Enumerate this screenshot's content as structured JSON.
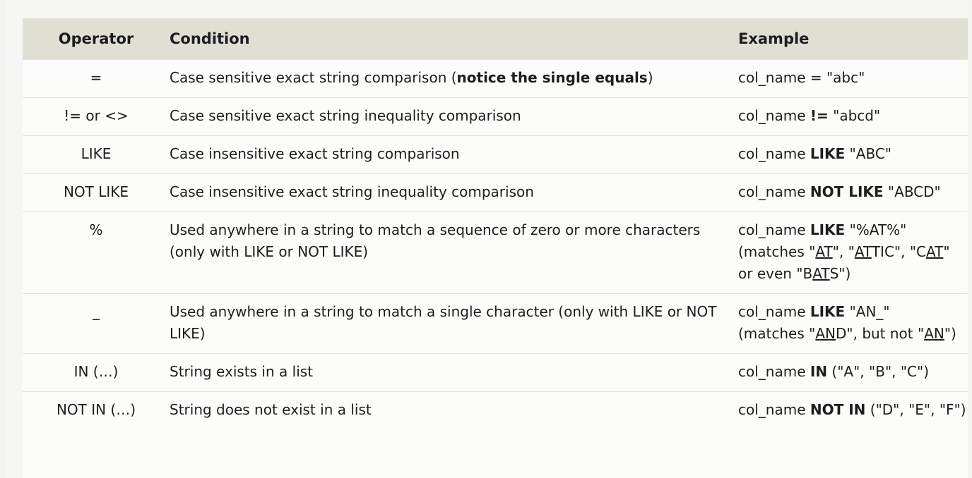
{
  "header": {
    "operator": "Operator",
    "condition": "Condition",
    "example": "Example"
  },
  "rows": [
    {
      "operator": "=",
      "condition_pre": "Case sensitive exact string comparison (",
      "condition_bold": "notice the single equals",
      "condition_post": ")",
      "ex_1": "col_name = \"abc\""
    },
    {
      "operator": "!= or <>",
      "condition": "Case sensitive exact string inequality comparison",
      "ex_1": "col_name ",
      "ex_bold": "!=",
      "ex_2": " \"abcd\""
    },
    {
      "operator": "LIKE",
      "condition": "Case insensitive exact string comparison",
      "ex_1": "col_name ",
      "ex_bold": "LIKE",
      "ex_2": " \"ABC\""
    },
    {
      "operator": "NOT LIKE",
      "condition": "Case insensitive exact string inequality comparison",
      "ex_1": "col_name ",
      "ex_bold": "NOT LIKE",
      "ex_2": " \"ABCD\""
    },
    {
      "operator": "%",
      "condition": "Used anywhere in a string to match a sequence of zero or more characters (only with LIKE or NOT LIKE)",
      "ex_1": "col_name ",
      "ex_bold": "LIKE",
      "ex_2": " \"%AT%\"",
      "m_open": "(matches \"",
      "m_u1": "AT",
      "m_t1": "\", \"",
      "m_u2": "AT",
      "m_t2": "TIC\", \"C",
      "m_u3": "AT",
      "m_t3": "\" or even \"B",
      "m_u4": "AT",
      "m_t4": "S\")"
    },
    {
      "operator": "_",
      "condition": "Used anywhere in a string to match a single character (only with LIKE or NOT LIKE)",
      "ex_1": "col_name ",
      "ex_bold": "LIKE",
      "ex_2": " \"AN_\"",
      "m_open": "(matches \"",
      "m_u1": "AN",
      "m_t1": "D\", but not \"",
      "m_u2": "AN",
      "m_t2": "\")"
    },
    {
      "operator": "IN (…)",
      "condition": "String exists in a list",
      "ex_1": "col_name ",
      "ex_bold": "IN",
      "ex_2": " (\"A\", \"B\", \"C\")"
    },
    {
      "operator": "NOT IN (…)",
      "condition": "String does not exist in a list",
      "ex_1": "col_name ",
      "ex_bold": "NOT IN",
      "ex_2": " (\"D\", \"E\", \"F\")"
    }
  ]
}
